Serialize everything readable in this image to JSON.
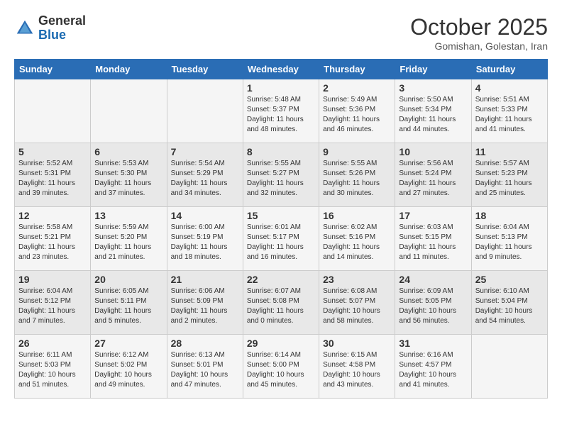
{
  "header": {
    "logo_general": "General",
    "logo_blue": "Blue",
    "month": "October 2025",
    "location": "Gomishan, Golestan, Iran"
  },
  "days_of_week": [
    "Sunday",
    "Monday",
    "Tuesday",
    "Wednesday",
    "Thursday",
    "Friday",
    "Saturday"
  ],
  "weeks": [
    [
      {
        "day": "",
        "info": ""
      },
      {
        "day": "",
        "info": ""
      },
      {
        "day": "",
        "info": ""
      },
      {
        "day": "1",
        "info": "Sunrise: 5:48 AM\nSunset: 5:37 PM\nDaylight: 11 hours\nand 48 minutes."
      },
      {
        "day": "2",
        "info": "Sunrise: 5:49 AM\nSunset: 5:36 PM\nDaylight: 11 hours\nand 46 minutes."
      },
      {
        "day": "3",
        "info": "Sunrise: 5:50 AM\nSunset: 5:34 PM\nDaylight: 11 hours\nand 44 minutes."
      },
      {
        "day": "4",
        "info": "Sunrise: 5:51 AM\nSunset: 5:33 PM\nDaylight: 11 hours\nand 41 minutes."
      }
    ],
    [
      {
        "day": "5",
        "info": "Sunrise: 5:52 AM\nSunset: 5:31 PM\nDaylight: 11 hours\nand 39 minutes."
      },
      {
        "day": "6",
        "info": "Sunrise: 5:53 AM\nSunset: 5:30 PM\nDaylight: 11 hours\nand 37 minutes."
      },
      {
        "day": "7",
        "info": "Sunrise: 5:54 AM\nSunset: 5:29 PM\nDaylight: 11 hours\nand 34 minutes."
      },
      {
        "day": "8",
        "info": "Sunrise: 5:55 AM\nSunset: 5:27 PM\nDaylight: 11 hours\nand 32 minutes."
      },
      {
        "day": "9",
        "info": "Sunrise: 5:55 AM\nSunset: 5:26 PM\nDaylight: 11 hours\nand 30 minutes."
      },
      {
        "day": "10",
        "info": "Sunrise: 5:56 AM\nSunset: 5:24 PM\nDaylight: 11 hours\nand 27 minutes."
      },
      {
        "day": "11",
        "info": "Sunrise: 5:57 AM\nSunset: 5:23 PM\nDaylight: 11 hours\nand 25 minutes."
      }
    ],
    [
      {
        "day": "12",
        "info": "Sunrise: 5:58 AM\nSunset: 5:21 PM\nDaylight: 11 hours\nand 23 minutes."
      },
      {
        "day": "13",
        "info": "Sunrise: 5:59 AM\nSunset: 5:20 PM\nDaylight: 11 hours\nand 21 minutes."
      },
      {
        "day": "14",
        "info": "Sunrise: 6:00 AM\nSunset: 5:19 PM\nDaylight: 11 hours\nand 18 minutes."
      },
      {
        "day": "15",
        "info": "Sunrise: 6:01 AM\nSunset: 5:17 PM\nDaylight: 11 hours\nand 16 minutes."
      },
      {
        "day": "16",
        "info": "Sunrise: 6:02 AM\nSunset: 5:16 PM\nDaylight: 11 hours\nand 14 minutes."
      },
      {
        "day": "17",
        "info": "Sunrise: 6:03 AM\nSunset: 5:15 PM\nDaylight: 11 hours\nand 11 minutes."
      },
      {
        "day": "18",
        "info": "Sunrise: 6:04 AM\nSunset: 5:13 PM\nDaylight: 11 hours\nand 9 minutes."
      }
    ],
    [
      {
        "day": "19",
        "info": "Sunrise: 6:04 AM\nSunset: 5:12 PM\nDaylight: 11 hours\nand 7 minutes."
      },
      {
        "day": "20",
        "info": "Sunrise: 6:05 AM\nSunset: 5:11 PM\nDaylight: 11 hours\nand 5 minutes."
      },
      {
        "day": "21",
        "info": "Sunrise: 6:06 AM\nSunset: 5:09 PM\nDaylight: 11 hours\nand 2 minutes."
      },
      {
        "day": "22",
        "info": "Sunrise: 6:07 AM\nSunset: 5:08 PM\nDaylight: 11 hours\nand 0 minutes."
      },
      {
        "day": "23",
        "info": "Sunrise: 6:08 AM\nSunset: 5:07 PM\nDaylight: 10 hours\nand 58 minutes."
      },
      {
        "day": "24",
        "info": "Sunrise: 6:09 AM\nSunset: 5:05 PM\nDaylight: 10 hours\nand 56 minutes."
      },
      {
        "day": "25",
        "info": "Sunrise: 6:10 AM\nSunset: 5:04 PM\nDaylight: 10 hours\nand 54 minutes."
      }
    ],
    [
      {
        "day": "26",
        "info": "Sunrise: 6:11 AM\nSunset: 5:03 PM\nDaylight: 10 hours\nand 51 minutes."
      },
      {
        "day": "27",
        "info": "Sunrise: 6:12 AM\nSunset: 5:02 PM\nDaylight: 10 hours\nand 49 minutes."
      },
      {
        "day": "28",
        "info": "Sunrise: 6:13 AM\nSunset: 5:01 PM\nDaylight: 10 hours\nand 47 minutes."
      },
      {
        "day": "29",
        "info": "Sunrise: 6:14 AM\nSunset: 5:00 PM\nDaylight: 10 hours\nand 45 minutes."
      },
      {
        "day": "30",
        "info": "Sunrise: 6:15 AM\nSunset: 4:58 PM\nDaylight: 10 hours\nand 43 minutes."
      },
      {
        "day": "31",
        "info": "Sunrise: 6:16 AM\nSunset: 4:57 PM\nDaylight: 10 hours\nand 41 minutes."
      },
      {
        "day": "",
        "info": ""
      }
    ]
  ]
}
